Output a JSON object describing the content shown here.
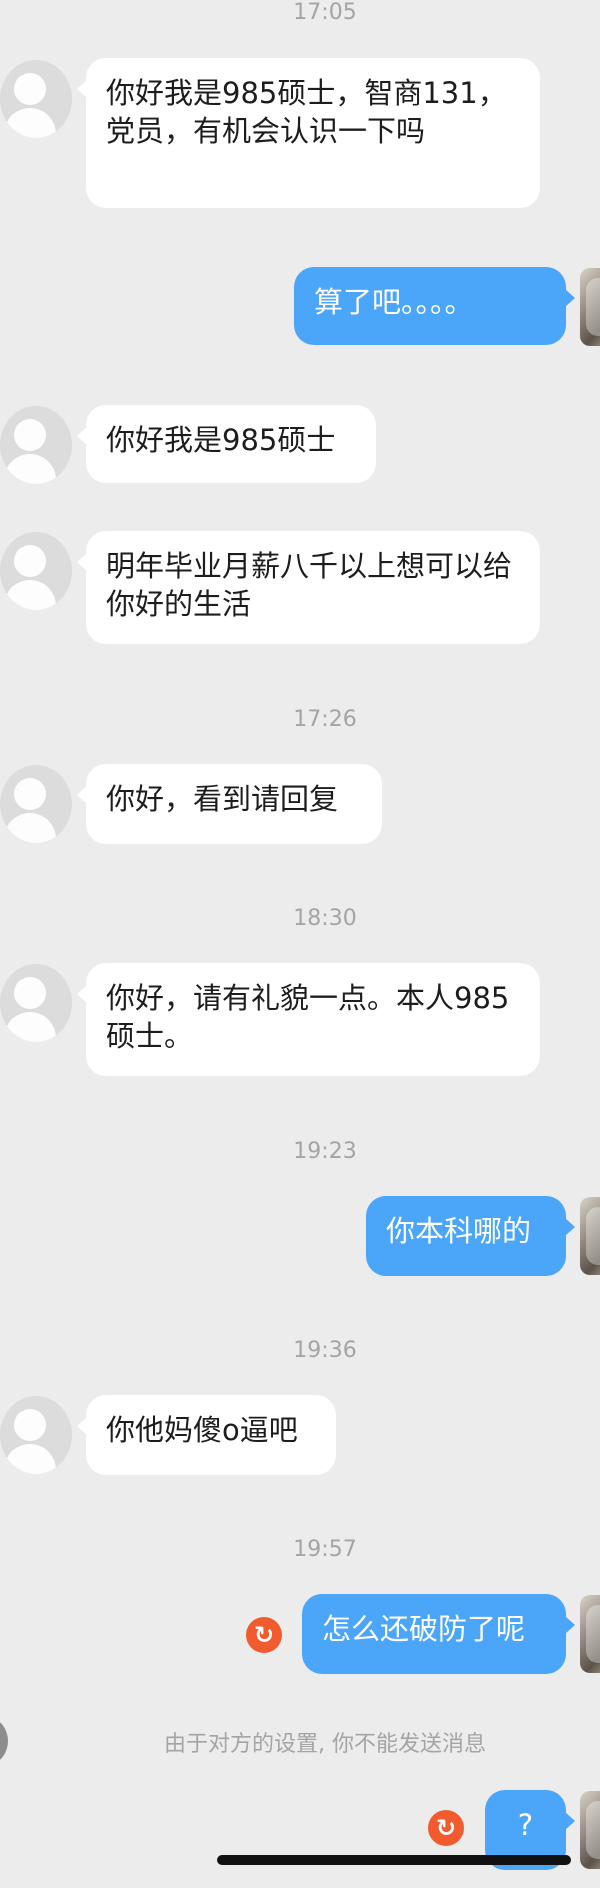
{
  "timestamps": [
    "17:05",
    "17:26",
    "18:30",
    "19:23",
    "19:36",
    "19:57"
  ],
  "messages": [
    {
      "side": "in",
      "text": "你好我是985硕士，智商131，党员，有机会认识一下吗"
    },
    {
      "side": "out",
      "text": "算了吧。。。。"
    },
    {
      "side": "in",
      "text": "你好我是985硕士"
    },
    {
      "side": "in",
      "text": "明年毕业月薪八千以上想可以给你好的生活"
    },
    {
      "side": "in",
      "text": "你好，看到请回复"
    },
    {
      "side": "in",
      "text": "你好，请有礼貌一点。本人985硕士。"
    },
    {
      "side": "out",
      "text": "你本科哪的"
    },
    {
      "side": "in",
      "text": "你他妈傻o逼吧"
    },
    {
      "side": "out",
      "text": "怎么还破防了呢",
      "failed": true
    },
    {
      "side": "out",
      "text": "?",
      "failed": true
    }
  ],
  "icons": {
    "failed": "retry-icon"
  },
  "failed_icon_glyph": "↻",
  "notice_text": "由于对方的设置, 你不能发送消息",
  "colors": {
    "background": "#ececec",
    "outgoing_bubble": "#4ba5f9",
    "incoming_bubble": "#ffffff",
    "failed_icon": "#f25b2d",
    "timestamp_text": "#a4a4a4"
  }
}
